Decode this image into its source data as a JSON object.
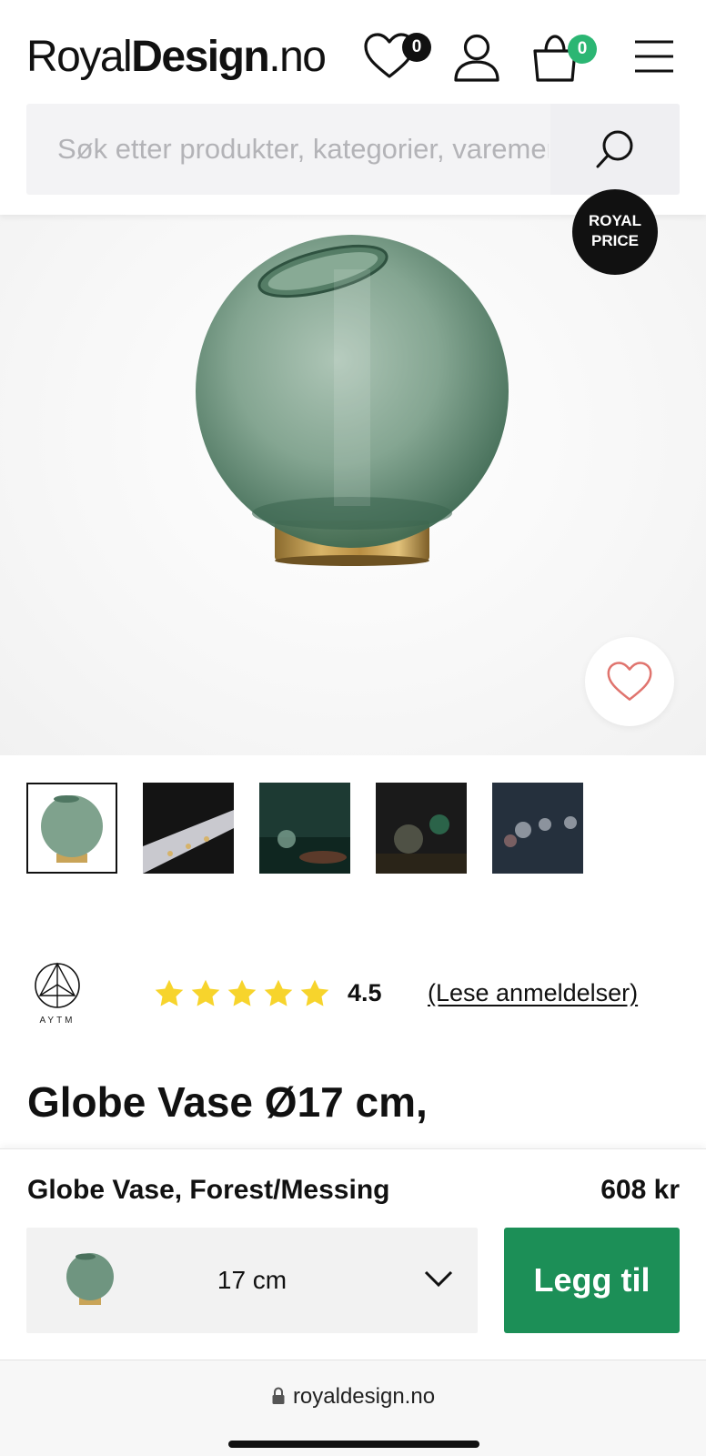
{
  "header": {
    "logo_part1": "Royal",
    "logo_part2": "Design",
    "logo_part3": ".no",
    "wishlist_count": "0",
    "cart_count": "0",
    "icons": [
      "heart-icon",
      "user-icon",
      "shopping-bag-icon",
      "hamburger-menu-icon",
      "search-icon"
    ]
  },
  "search": {
    "placeholder": "Søk etter produkter, kategorier, varemerker"
  },
  "hero": {
    "badge_line1": "ROYAL",
    "badge_line2": "PRICE"
  },
  "thumbnails": [
    {
      "label": "Globe Vase forest"
    },
    {
      "label": "Vase in dark setting 1"
    },
    {
      "label": "Vase in dark setting 2"
    },
    {
      "label": "Vase in dark setting 3"
    },
    {
      "label": "Vase in dark setting 4"
    }
  ],
  "brand": {
    "name": "AYTM"
  },
  "rating": {
    "value": "4.5",
    "stars_filled": 5,
    "reviews_link": "(Lese anmeldelser)"
  },
  "product": {
    "title": "Globe Vase Ø17 cm,"
  },
  "buybar": {
    "name": "Globe Vase, Forest/Messing",
    "price": "608 kr",
    "variant": "17 cm",
    "add_label": "Legg til"
  },
  "browser": {
    "url": "royaldesign.no"
  },
  "colors": {
    "accent_green": "#1c8f57",
    "cart_badge": "#2bb673",
    "star_yellow": "#f7d42c"
  }
}
